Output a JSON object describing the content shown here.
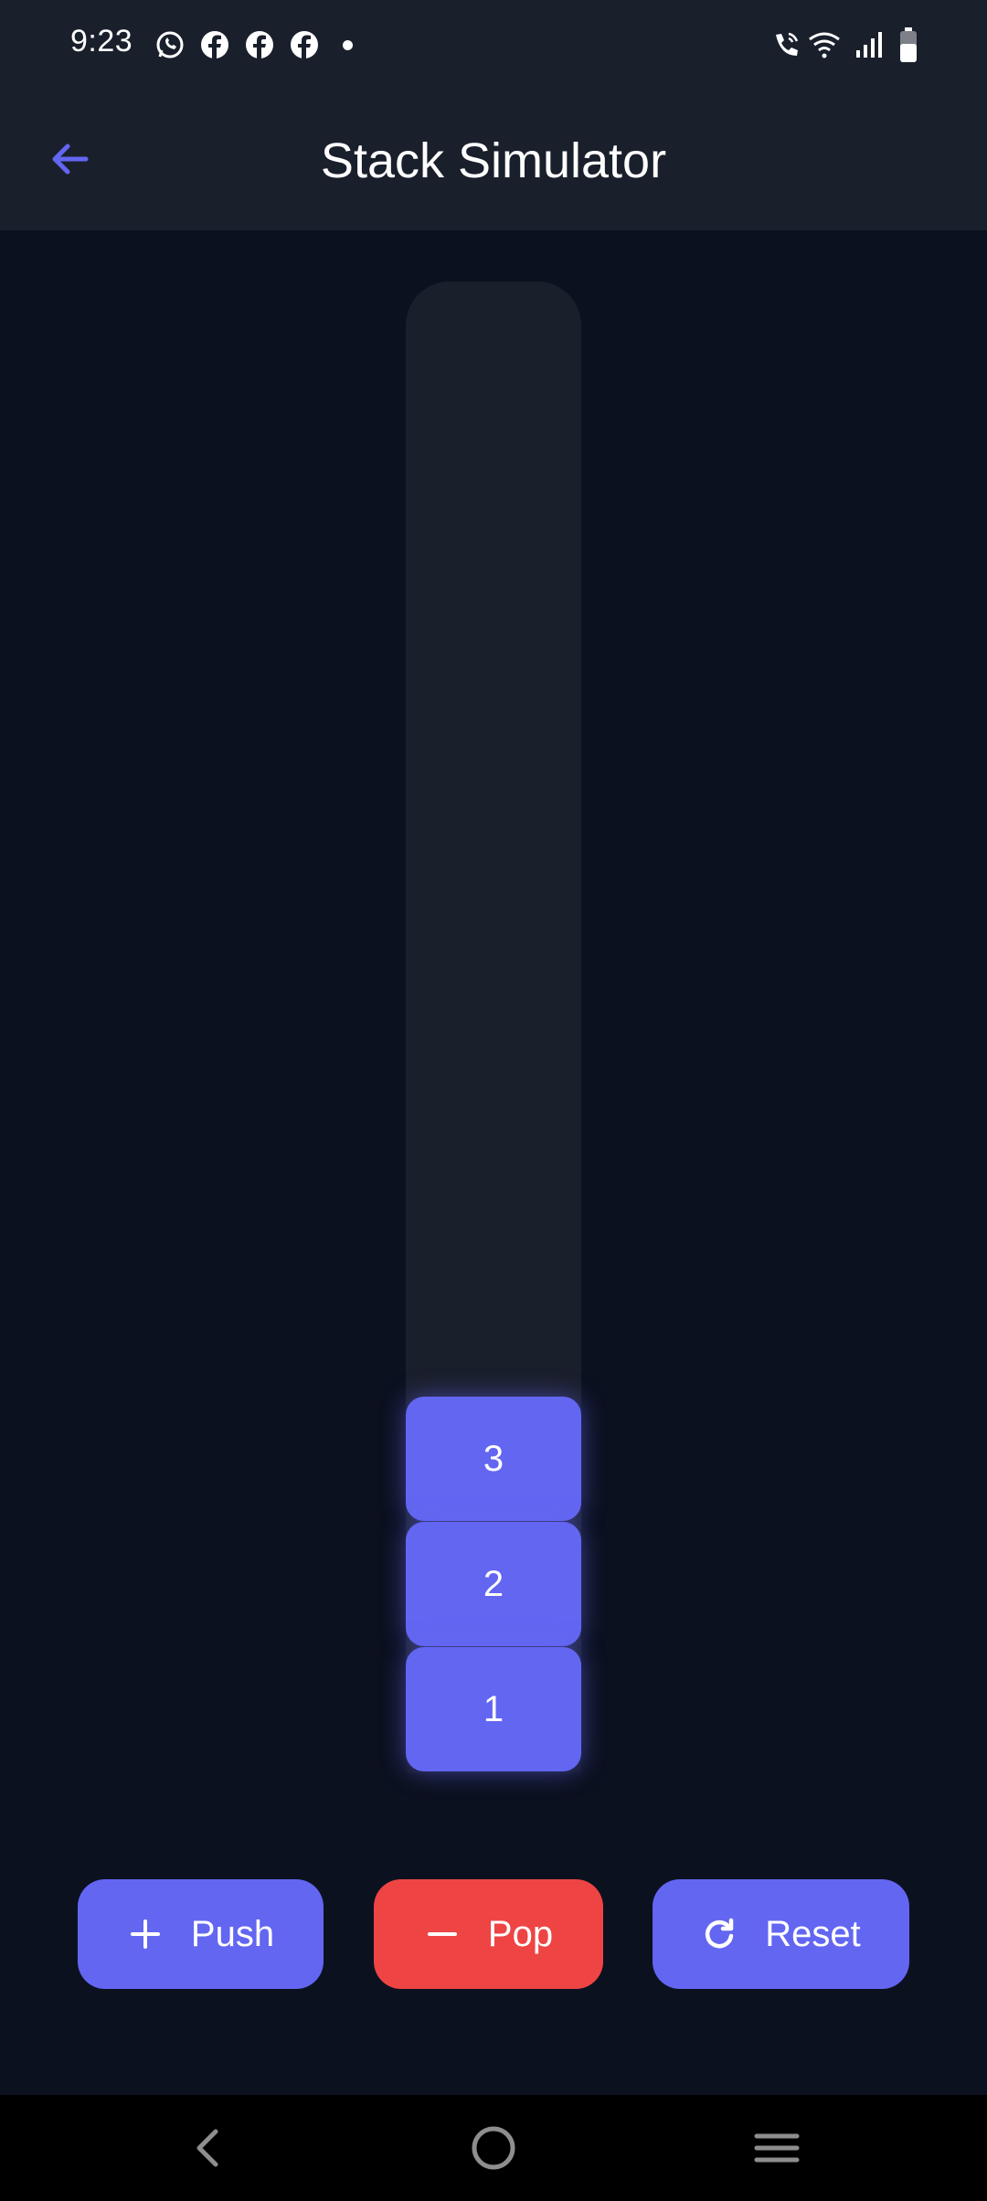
{
  "status_bar": {
    "time": "9:23",
    "left_icons": [
      "whatsapp-icon",
      "facebook-icon",
      "facebook-icon",
      "facebook-icon",
      "notification-dot"
    ],
    "right_icons": [
      "wifi-call-icon",
      "wifi-icon",
      "signal-icon",
      "battery-icon"
    ]
  },
  "app_bar": {
    "title": "Stack Simulator",
    "back_icon": "arrow-left-icon"
  },
  "stack": {
    "items": [
      "3",
      "2",
      "1"
    ]
  },
  "actions": {
    "push_label": "Push",
    "pop_label": "Pop",
    "reset_label": "Reset"
  },
  "colors": {
    "background": "#0c1120",
    "surface": "#1a1f2c",
    "accent": "#6366f1",
    "danger": "#ef4444",
    "text": "#ffffff"
  },
  "nav_bar": {
    "icons": [
      "nav-back-icon",
      "nav-home-icon",
      "nav-recents-icon"
    ]
  }
}
